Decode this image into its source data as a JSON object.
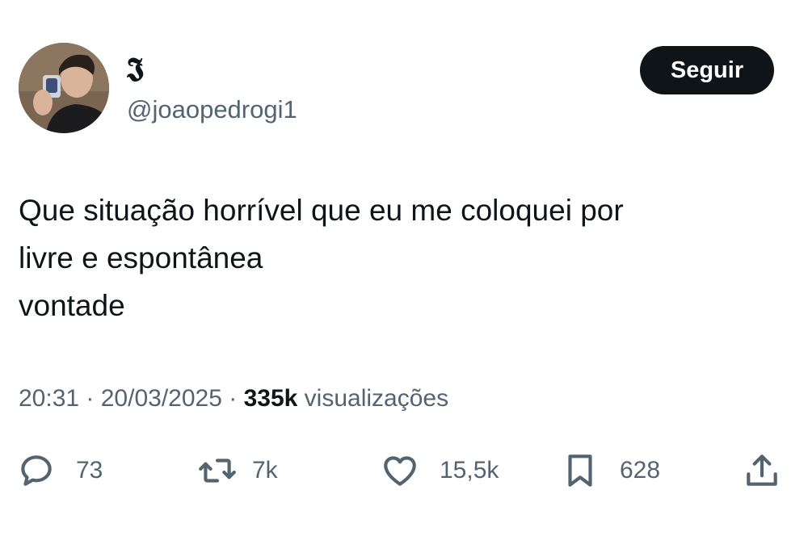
{
  "user": {
    "display_name": "𝕵",
    "handle": "@joaopedrogi1"
  },
  "follow_label": "Seguir",
  "tweet": {
    "text_lines": [
      "Que situação horrível que eu me coloquei por",
      "livre e espontânea",
      "vontade"
    ]
  },
  "meta": {
    "time": "20:31",
    "sep1": " · ",
    "date": "20/03/2025",
    "sep2": " · ",
    "views_count": "335k",
    "views_label": " visualizações"
  },
  "actions": {
    "replies": "73",
    "retweets": "7k",
    "likes": "15,5k",
    "bookmarks": "628"
  },
  "colors": {
    "text": "#0f1419",
    "secondary": "#536471",
    "button_bg": "#0f1419",
    "button_text": "#ffffff"
  },
  "icons": [
    "reply-icon",
    "retweet-icon",
    "like-icon",
    "bookmark-icon",
    "share-icon"
  ]
}
